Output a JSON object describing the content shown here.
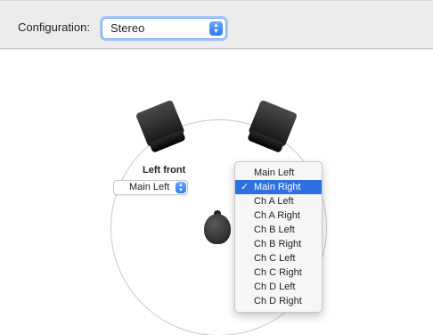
{
  "toolbar": {
    "configuration_label": "Configuration:",
    "configuration_value": "Stereo"
  },
  "speakers": {
    "left_front_label": "Left front",
    "left_front_channel": "Main Left"
  },
  "channel_menu": {
    "items": [
      {
        "label": "Main Left",
        "selected": false
      },
      {
        "label": "Main Right",
        "selected": true
      },
      {
        "label": "Ch A Left",
        "selected": false
      },
      {
        "label": "Ch A Right",
        "selected": false
      },
      {
        "label": "Ch B Left",
        "selected": false
      },
      {
        "label": "Ch B Right",
        "selected": false
      },
      {
        "label": "Ch C Left",
        "selected": false
      },
      {
        "label": "Ch C Right",
        "selected": false
      },
      {
        "label": "Ch D Left",
        "selected": false
      },
      {
        "label": "Ch D Right",
        "selected": false
      }
    ],
    "check_glyph": "✓"
  },
  "colors": {
    "accent": "#2f6fe4",
    "focus_ring": "#a9c9f7"
  }
}
